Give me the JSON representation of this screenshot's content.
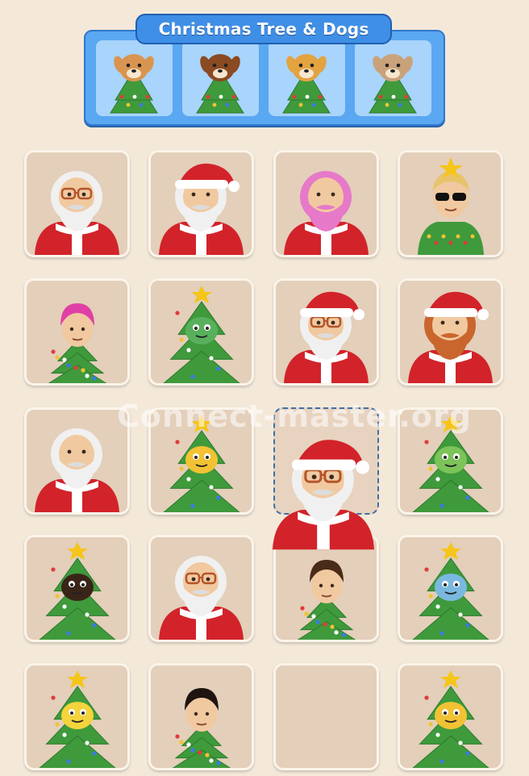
{
  "category": {
    "title": "Christmas Tree & Dogs",
    "slots": [
      {
        "icon": "corgi-tree-icon",
        "fur": "#d99550"
      },
      {
        "icon": "brown-dog-tree-icon",
        "fur": "#8a4a22"
      },
      {
        "icon": "golden-retriever-tree-icon",
        "fur": "#e3a340"
      },
      {
        "icon": "pug-tree-icon",
        "fur": "#c9a27a"
      }
    ]
  },
  "board": {
    "tiles": [
      {
        "icon": "santa-glasses-icon",
        "kind": "santa",
        "hat": false,
        "glasses": true,
        "hair": "#f0f0f0"
      },
      {
        "icon": "santa-hat-mustache-icon",
        "kind": "santa",
        "hat": true,
        "glasses": false,
        "hair": "#f0f0f0"
      },
      {
        "icon": "pink-hair-santa-icon",
        "kind": "santa",
        "hat": false,
        "glasses": false,
        "hair": "#e779c9"
      },
      {
        "icon": "star-sunglasses-kid-icon",
        "kind": "kid-sweater",
        "hair": "#e8c36a",
        "star": true,
        "sunglasses": true
      },
      {
        "icon": "pink-hair-tree-person-icon",
        "kind": "tree-person",
        "hair": "#e040a6"
      },
      {
        "icon": "dinosaur-tree-icon",
        "kind": "creature-tree",
        "face": "#58b05c"
      },
      {
        "icon": "santa-hat-glasses-icon",
        "kind": "santa",
        "hat": true,
        "glasses": true,
        "hair": "#f0f0f0"
      },
      {
        "icon": "ginger-santa-icon",
        "kind": "santa",
        "hat": true,
        "glasses": false,
        "hair": "#c9662e"
      },
      {
        "icon": "long-hair-santa-icon",
        "kind": "santa",
        "hat": false,
        "glasses": false,
        "hair": "#f0f0f0"
      },
      {
        "icon": "bee-tree-icon",
        "kind": "creature-tree",
        "face": "#f2c234"
      },
      {
        "icon": "empty-slot",
        "kind": "selected"
      },
      {
        "icon": "frog-tree-icon",
        "kind": "creature-tree",
        "face": "#7cc35a"
      },
      {
        "icon": "ant-santa-hat-tree-icon",
        "kind": "creature-tree",
        "face": "#3a2418"
      },
      {
        "icon": "santa-glasses-beard-icon",
        "kind": "santa",
        "hat": false,
        "glasses": true,
        "hair": "#f0f0f0"
      },
      {
        "icon": "girl-tree-icon",
        "kind": "tree-person",
        "hair": "#4a2a18"
      },
      {
        "icon": "bird-tree-icon",
        "kind": "creature-tree",
        "face": "#7ab8e0"
      },
      {
        "icon": "chick-tree-icon",
        "kind": "creature-tree",
        "face": "#f5d33c"
      },
      {
        "icon": "curly-hair-kid-tree-icon",
        "kind": "tree-person",
        "hair": "#1f1410"
      },
      {
        "icon": "empty-slot",
        "kind": "empty"
      },
      {
        "icon": "bee-ornament-tree-icon",
        "kind": "creature-tree",
        "face": "#f2c234"
      }
    ]
  },
  "dragged_piece": {
    "icon": "dragged-santa-glasses-icon"
  },
  "watermark": "Connect-master.org",
  "colors": {
    "background": "#f4e9d9",
    "tile": "#e3cfba",
    "panel": "#5aa7f2",
    "santa_red": "#d2232a",
    "tree_green": "#3f9a3c"
  }
}
